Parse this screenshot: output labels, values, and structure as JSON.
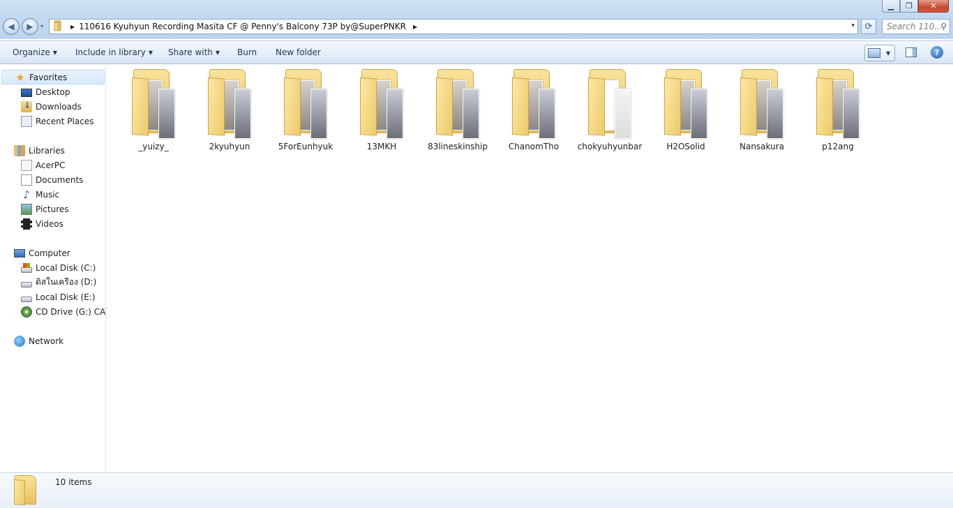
{
  "window": {
    "controls": {
      "minimize": "▁",
      "restore": "❐",
      "close": "✕"
    }
  },
  "nav": {
    "back": "◀",
    "forward": "▶",
    "history_dropdown": "▾"
  },
  "address": {
    "separator": "▶",
    "path": "110616 Kyuhyun Recording Masita CF @ Penny's Balcony 73P by@SuperPNKR",
    "dropdown": "▾",
    "refresh": "⟳"
  },
  "search": {
    "placeholder": "Search 110...",
    "icon": "⚲"
  },
  "toolbar": {
    "organize": "Organize",
    "include_in_library": "Include in library",
    "share_with": "Share with",
    "burn": "Burn",
    "new_folder": "New folder",
    "dropdown_caret": "▼",
    "help": "?"
  },
  "sidebar": {
    "favorites": {
      "label": "Favorites",
      "items": [
        "Desktop",
        "Downloads",
        "Recent Places"
      ]
    },
    "libraries": {
      "label": "Libraries",
      "items": [
        "AcerPC",
        "Documents",
        "Music",
        "Pictures",
        "Videos"
      ]
    },
    "computer": {
      "label": "Computer",
      "items": [
        "Local Disk (C:)",
        "ดิสในเครือง (D:)",
        "Local Disk (E:)",
        "CD Drive (G:) CAT C"
      ]
    },
    "network": {
      "label": "Network"
    }
  },
  "icons": {
    "favorites": "star-icon",
    "music": "♪"
  },
  "folders": [
    "_yuizy_",
    "2kyuhyun",
    "5ForEunhyuk",
    "13MKH",
    "83lineskinship",
    "ChanomTho",
    "chokyuhyunbar",
    "H2OSolid",
    "Nansakura",
    "p12ang"
  ],
  "status": {
    "item_count": "10 items"
  }
}
